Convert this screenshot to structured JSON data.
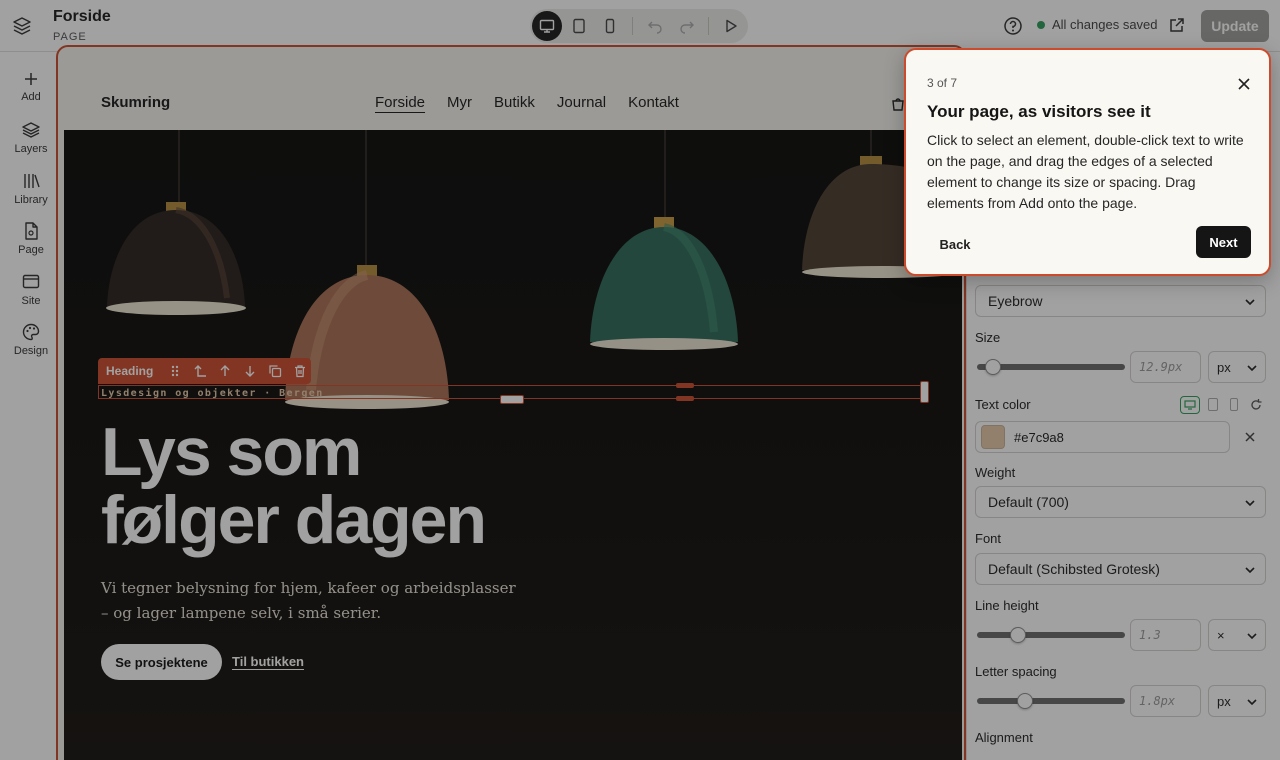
{
  "header": {
    "title": "Forside",
    "subtitle": "PAGE",
    "status": "All changes saved",
    "update_label": "Update"
  },
  "device_toolbar": {
    "buttons": [
      "desktop-icon",
      "tablet-icon",
      "mobile-icon",
      "undo-icon",
      "redo-icon",
      "preview-play-icon"
    ],
    "active": "desktop-icon"
  },
  "rail": {
    "items": [
      {
        "label": "Add",
        "icon": "plus-icon"
      },
      {
        "label": "Layers",
        "icon": "layers-icon"
      },
      {
        "label": "Library",
        "icon": "library-icon"
      },
      {
        "label": "Page",
        "icon": "page-icon"
      },
      {
        "label": "Site",
        "icon": "site-icon"
      },
      {
        "label": "Design",
        "icon": "palette-icon"
      }
    ]
  },
  "site": {
    "brand": "Skumring",
    "nav": [
      "Forside",
      "Myr",
      "Butikk",
      "Journal",
      "Kontakt"
    ],
    "nav_current": "Forside",
    "eyebrow": "Lysdesign og objekter · Bergen",
    "headline_line1": "Lys som",
    "headline_line2": "følger dagen",
    "lede": "Vi tegner belysning for hjem, kafeer og arbeidsplasser – og lager lampene selv, i små serier.",
    "cta_primary": "Se prosjektene",
    "cta_secondary": "Til butikken"
  },
  "selection": {
    "label": "Heading",
    "tools": [
      "drag-handle-icon",
      "select-parent-icon",
      "move-up-icon",
      "move-down-icon",
      "duplicate-icon",
      "delete-icon"
    ]
  },
  "panel": {
    "style_value": "Eyebrow",
    "size_label": "Size",
    "size_value": "12.9px",
    "size_unit": "px",
    "size_level": 0.06,
    "text_color_label": "Text color",
    "text_color_value": "#e7c9a8",
    "weight_label": "Weight",
    "weight_value": "Default (700)",
    "font_label": "Font",
    "font_value": "Default (Schibsted Grotesk)",
    "line_height_label": "Line height",
    "line_height_value": "1.3",
    "line_height_unit": "×",
    "line_height_level": 0.25,
    "letter_spacing_label": "Letter spacing",
    "letter_spacing_value": "1.8px",
    "letter_spacing_unit": "px",
    "letter_spacing_level": 0.3,
    "alignment_label": "Alignment"
  },
  "tour": {
    "step": "3 of 7",
    "title": "Your page, as visitors see it",
    "body": "Click to select an element, double-click text to write on the page, and drag the edges of a selected element to change its size or spacing. Drag elements from Add onto the page.",
    "back_label": "Back",
    "next_label": "Next"
  },
  "colors": {
    "accent": "#cc4b2c",
    "saved_dot": "#2e9d5b",
    "eyebrow": "#e7c9a8"
  }
}
